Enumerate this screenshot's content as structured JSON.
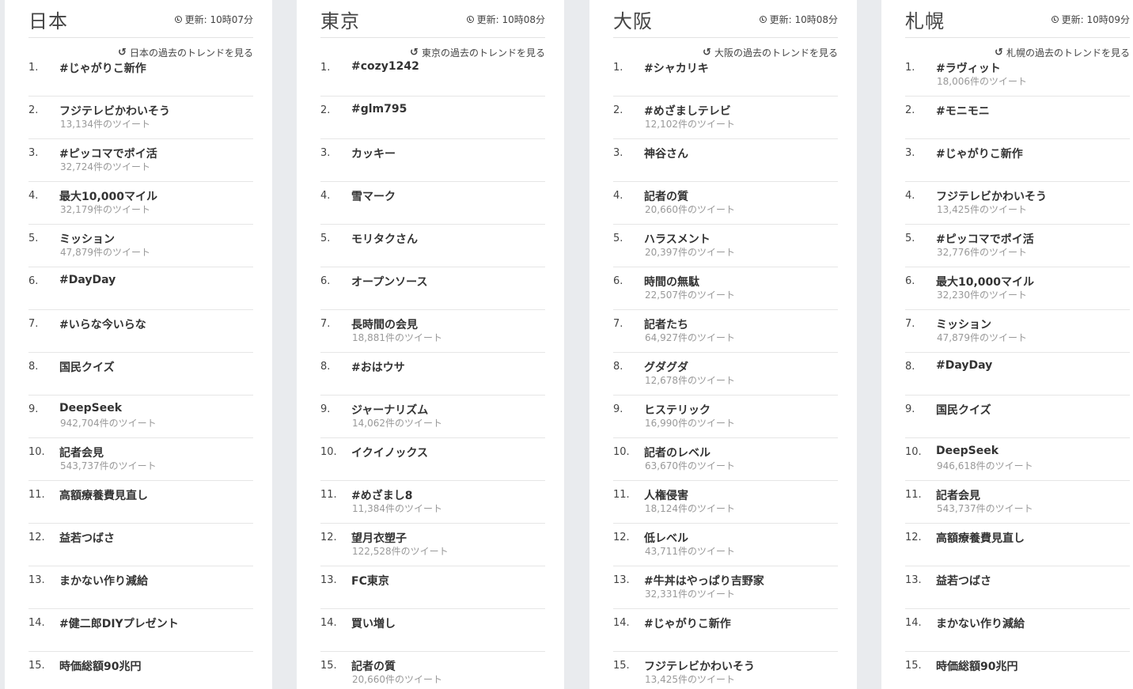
{
  "columns": [
    {
      "title": "日本",
      "updated": "更新: 10時07分",
      "past_link": "日本の過去のトレンドを見る",
      "trends": [
        {
          "rank": "1.",
          "name": "#じゃがりこ新作",
          "count": ""
        },
        {
          "rank": "2.",
          "name": "フジテレビかわいそう",
          "count": "13,134件のツイート"
        },
        {
          "rank": "3.",
          "name": "#ピッコマでポイ活",
          "count": "32,724件のツイート"
        },
        {
          "rank": "4.",
          "name": "最大10,000マイル",
          "count": "32,179件のツイート"
        },
        {
          "rank": "5.",
          "name": "ミッション",
          "count": "47,879件のツイート"
        },
        {
          "rank": "6.",
          "name": "#DayDay",
          "count": ""
        },
        {
          "rank": "7.",
          "name": "#いらな今いらな",
          "count": ""
        },
        {
          "rank": "8.",
          "name": "国民クイズ",
          "count": ""
        },
        {
          "rank": "9.",
          "name": "DeepSeek",
          "count": "942,704件のツイート"
        },
        {
          "rank": "10.",
          "name": "記者会見",
          "count": "543,737件のツイート"
        },
        {
          "rank": "11.",
          "name": "高額療養費見直し",
          "count": ""
        },
        {
          "rank": "12.",
          "name": "益若つばさ",
          "count": ""
        },
        {
          "rank": "13.",
          "name": "まかない作り減給",
          "count": ""
        },
        {
          "rank": "14.",
          "name": "#健二郎DIYプレゼント",
          "count": ""
        },
        {
          "rank": "15.",
          "name": "時価総額90兆円",
          "count": ""
        }
      ]
    },
    {
      "title": "東京",
      "updated": "更新: 10時08分",
      "past_link": "東京の過去のトレンドを見る",
      "trends": [
        {
          "rank": "1.",
          "name": "#cozy1242",
          "count": ""
        },
        {
          "rank": "2.",
          "name": "#glm795",
          "count": ""
        },
        {
          "rank": "3.",
          "name": "カッキー",
          "count": ""
        },
        {
          "rank": "4.",
          "name": "雪マーク",
          "count": ""
        },
        {
          "rank": "5.",
          "name": "モリタクさん",
          "count": ""
        },
        {
          "rank": "6.",
          "name": "オープンソース",
          "count": ""
        },
        {
          "rank": "7.",
          "name": "長時間の会見",
          "count": "18,881件のツイート"
        },
        {
          "rank": "8.",
          "name": "#おはウサ",
          "count": ""
        },
        {
          "rank": "9.",
          "name": "ジャーナリズム",
          "count": "14,062件のツイート"
        },
        {
          "rank": "10.",
          "name": "イクイノックス",
          "count": ""
        },
        {
          "rank": "11.",
          "name": "#めざまし8",
          "count": "11,384件のツイート"
        },
        {
          "rank": "12.",
          "name": "望月衣塑子",
          "count": "122,528件のツイート"
        },
        {
          "rank": "13.",
          "name": "FC東京",
          "count": ""
        },
        {
          "rank": "14.",
          "name": "買い増し",
          "count": ""
        },
        {
          "rank": "15.",
          "name": "記者の質",
          "count": "20,660件のツイート"
        }
      ]
    },
    {
      "title": "大阪",
      "updated": "更新: 10時08分",
      "past_link": "大阪の過去のトレンドを見る",
      "trends": [
        {
          "rank": "1.",
          "name": "#シャカリキ",
          "count": ""
        },
        {
          "rank": "2.",
          "name": "#めざましテレビ",
          "count": "12,102件のツイート"
        },
        {
          "rank": "3.",
          "name": "神谷さん",
          "count": ""
        },
        {
          "rank": "4.",
          "name": "記者の質",
          "count": "20,660件のツイート"
        },
        {
          "rank": "5.",
          "name": "ハラスメント",
          "count": "20,397件のツイート"
        },
        {
          "rank": "6.",
          "name": "時間の無駄",
          "count": "22,507件のツイート"
        },
        {
          "rank": "7.",
          "name": "記者たち",
          "count": "64,927件のツイート"
        },
        {
          "rank": "8.",
          "name": "グダグダ",
          "count": "12,678件のツイート"
        },
        {
          "rank": "9.",
          "name": "ヒステリック",
          "count": "16,990件のツイート"
        },
        {
          "rank": "10.",
          "name": "記者のレベル",
          "count": "63,670件のツイート"
        },
        {
          "rank": "11.",
          "name": "人権侵害",
          "count": "18,124件のツイート"
        },
        {
          "rank": "12.",
          "name": "低レベル",
          "count": "43,711件のツイート"
        },
        {
          "rank": "13.",
          "name": "#牛丼はやっぱり吉野家",
          "count": "32,331件のツイート"
        },
        {
          "rank": "14.",
          "name": "#じゃがりこ新作",
          "count": ""
        },
        {
          "rank": "15.",
          "name": "フジテレビかわいそう",
          "count": "13,425件のツイート"
        }
      ]
    },
    {
      "title": "札幌",
      "updated": "更新: 10時09分",
      "past_link": "札幌の過去のトレンドを見る",
      "trends": [
        {
          "rank": "1.",
          "name": "#ラヴィット",
          "count": "18,006件のツイート"
        },
        {
          "rank": "2.",
          "name": "#モニモニ",
          "count": ""
        },
        {
          "rank": "3.",
          "name": "#じゃがりこ新作",
          "count": ""
        },
        {
          "rank": "4.",
          "name": "フジテレビかわいそう",
          "count": "13,425件のツイート"
        },
        {
          "rank": "5.",
          "name": "#ピッコマでポイ活",
          "count": "32,776件のツイート"
        },
        {
          "rank": "6.",
          "name": "最大10,000マイル",
          "count": "32,230件のツイート"
        },
        {
          "rank": "7.",
          "name": "ミッション",
          "count": "47,879件のツイート"
        },
        {
          "rank": "8.",
          "name": "#DayDay",
          "count": ""
        },
        {
          "rank": "9.",
          "name": "国民クイズ",
          "count": ""
        },
        {
          "rank": "10.",
          "name": "DeepSeek",
          "count": "946,618件のツイート"
        },
        {
          "rank": "11.",
          "name": "記者会見",
          "count": "543,737件のツイート"
        },
        {
          "rank": "12.",
          "name": "高額療養費見直し",
          "count": ""
        },
        {
          "rank": "13.",
          "name": "益若つばさ",
          "count": ""
        },
        {
          "rank": "14.",
          "name": "まかない作り減給",
          "count": ""
        },
        {
          "rank": "15.",
          "name": "時価総額90兆円",
          "count": ""
        }
      ]
    }
  ]
}
